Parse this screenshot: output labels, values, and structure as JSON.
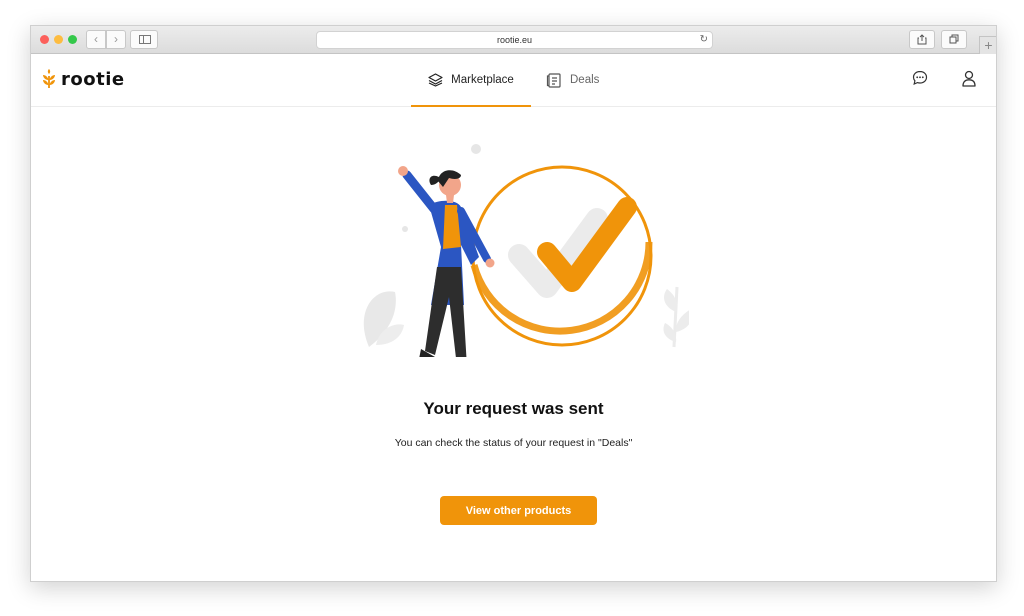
{
  "browser": {
    "url": "rootie.eu",
    "back_glyph": "‹",
    "forward_glyph": "›",
    "new_tab_glyph": "+"
  },
  "app": {
    "logo_text": "rootie",
    "brand_color": "#f0940a"
  },
  "nav": {
    "tabs": [
      {
        "label": "Marketplace",
        "icon": "layers-icon",
        "active": true
      },
      {
        "label": "Deals",
        "icon": "document-list-icon",
        "active": false
      }
    ]
  },
  "header_icons": [
    "chat-bubble-icon",
    "user-icon"
  ],
  "main": {
    "illustration": "woman-celebrating-checkmark-illustration",
    "title": "Your request was sent",
    "subtitle": "You can check the status of your request in \"Deals\"",
    "cta_label": "View other products"
  }
}
